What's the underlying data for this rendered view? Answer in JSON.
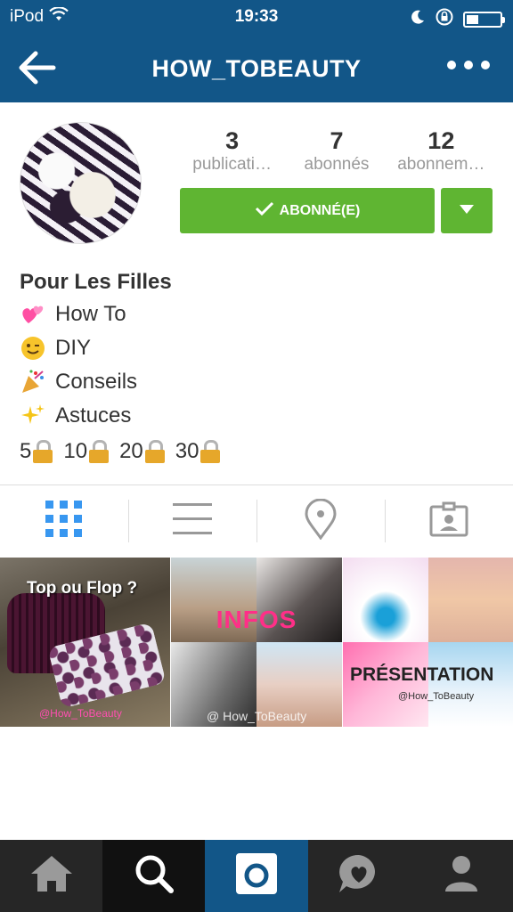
{
  "status": {
    "carrier": "iPod",
    "time": "19:33",
    "battery_level": 0.35
  },
  "nav": {
    "title": "HOW_TOBEAUTY",
    "back_icon": "back-arrow-icon",
    "more_icon": "more-dots-icon"
  },
  "profile": {
    "stats": [
      {
        "count": "3",
        "label": "publicati…"
      },
      {
        "count": "7",
        "label": "abonnés"
      },
      {
        "count": "12",
        "label": "abonnem…"
      }
    ],
    "follow_label": "ABONNÉ(E)",
    "bio": {
      "name": "Pour Les Filles",
      "lines": [
        {
          "emoji": "💞",
          "text": "How To"
        },
        {
          "emoji": "😉",
          "text": "DIY"
        },
        {
          "emoji": "🎉",
          "text": "Conseils"
        },
        {
          "emoji": "✨",
          "text": "Astuces"
        }
      ],
      "numbers": [
        "5",
        "10",
        "20",
        "30"
      ]
    }
  },
  "tabs": [
    "grid-icon",
    "list-icon",
    "location-icon",
    "tagged-icon"
  ],
  "posts": [
    {
      "title": "Top ou Flop ?",
      "credit": "@How_ToBeauty"
    },
    {
      "title": "INFOS",
      "credit": "@ How_ToBeauty"
    },
    {
      "title": "PRÉSENTATION",
      "credit": "@How_ToBeauty"
    }
  ],
  "colors": {
    "nav_bg": "#125688",
    "follow_green": "#5fb532",
    "active_tab": "#3897f0",
    "bottom_bar": "#262626"
  },
  "bottom_nav": [
    "home-icon",
    "search-icon",
    "camera-icon",
    "activity-icon",
    "profile-icon"
  ]
}
